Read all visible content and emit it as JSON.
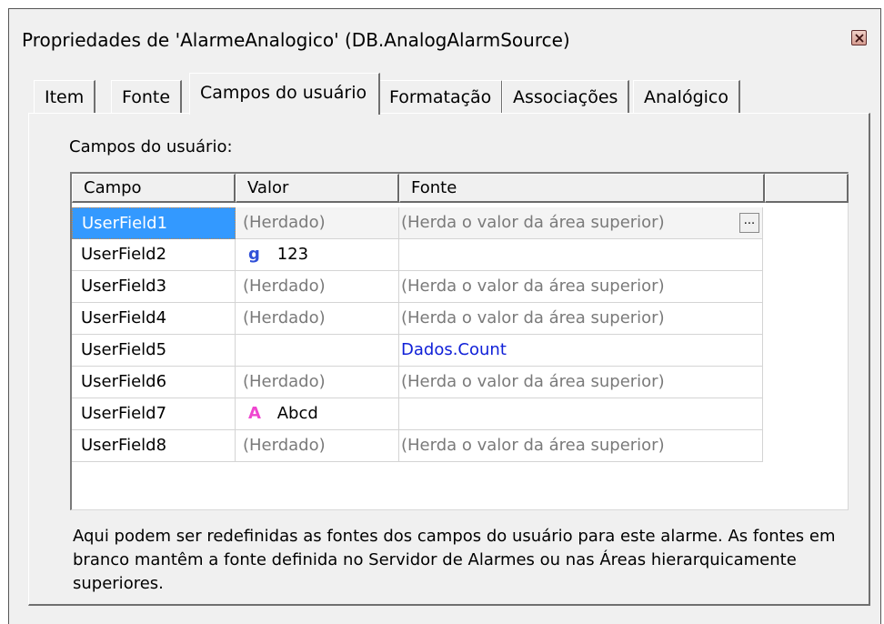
{
  "window": {
    "title": "Propriedades de 'AlarmeAnalogico' (DB.AnalogAlarmSource)"
  },
  "tabs": [
    {
      "label": "Item"
    },
    {
      "label": "Fonte"
    },
    {
      "label": "Campos do usuário",
      "active": true
    },
    {
      "label": "Formatação"
    },
    {
      "label": "Associações"
    },
    {
      "label": "Analógico"
    }
  ],
  "panel": {
    "section_label": "Campos do usuário:",
    "columns": [
      "Campo",
      "Valor",
      "Fonte"
    ],
    "rows": [
      {
        "campo": "UserField1",
        "valor": "(Herdado)",
        "fonte": "(Herda o valor da área superior)",
        "button": "..."
      },
      {
        "campo": "UserField2",
        "valor_icon": "g",
        "valor": "123",
        "fonte": ""
      },
      {
        "campo": "UserField3",
        "valor": "(Herdado)",
        "fonte": "(Herda o valor da área superior)"
      },
      {
        "campo": "UserField4",
        "valor": "(Herdado)",
        "fonte": "(Herda o valor da área superior)"
      },
      {
        "campo": "UserField5",
        "valor": "",
        "fonte": "Dados.Count"
      },
      {
        "campo": "UserField6",
        "valor": "(Herdado)",
        "fonte": "(Herda o valor da área superior)"
      },
      {
        "campo": "UserField7",
        "valor_icon": "A",
        "valor": "Abcd",
        "fonte": ""
      },
      {
        "campo": "UserField8",
        "valor": "(Herdado)",
        "fonte": "(Herda o valor da área superior)"
      }
    ],
    "help_text": "Aqui podem ser redefinidas as fontes dos campos do usuário para este alarme. As fontes em branco mantêm a fonte definida no Servidor de Alarmes ou nas Áreas hierarquicamente superiores."
  },
  "icons": {
    "close": "close-icon",
    "tag_value": "tag-value-icon",
    "text_value": "text-value-icon"
  },
  "colors": {
    "selection": "#3399ff",
    "link": "#1020d8",
    "tag_icon": "#3050d8",
    "text_icon": "#ef46d0"
  }
}
